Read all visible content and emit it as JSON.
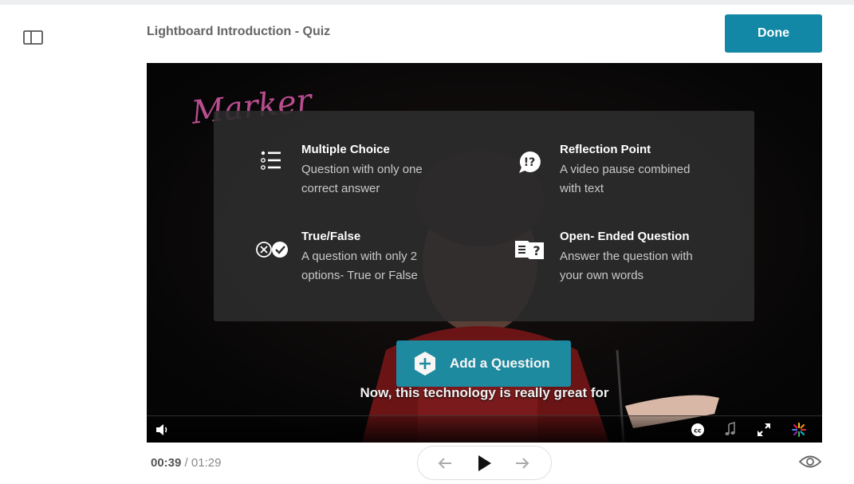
{
  "header": {
    "title": "Lightboard Introduction - Quiz",
    "done_label": "Done"
  },
  "video": {
    "subtitle": "Now, this technology is really great for",
    "marker_text": "Marker"
  },
  "question_types": [
    {
      "name": "Multiple Choice",
      "description": "Question with only one correct answer",
      "icon": "list-icon"
    },
    {
      "name": "Reflection Point",
      "description": "A video pause combined with text",
      "icon": "speech-bubble-exclaim-question-icon"
    },
    {
      "name": "True/False",
      "description": "A question with only 2 options- True or False",
      "icon": "x-check-icon"
    },
    {
      "name": "Open- Ended Question",
      "description": "Answer the question with your own words",
      "icon": "text-question-icon"
    }
  ],
  "add_question_label": "Add a Question",
  "playback": {
    "current_time": "00:39",
    "separator": " / ",
    "total_time": "01:29"
  },
  "colors": {
    "accent": "#1388a6",
    "overlay": "#2c2c2c"
  }
}
